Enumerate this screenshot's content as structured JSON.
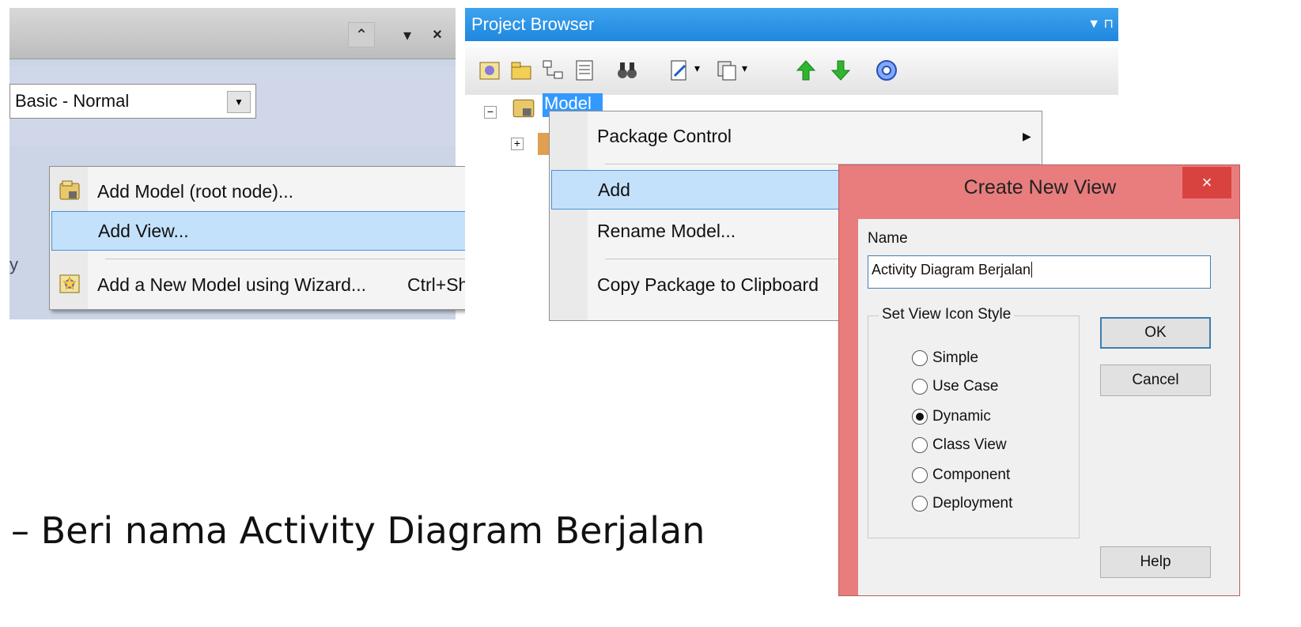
{
  "left_panel": {
    "style_select_value": "Basic - Normal",
    "stub_text": "y"
  },
  "add_submenu": {
    "items": [
      {
        "label": "Add Model (root node)...",
        "shortcut": ""
      },
      {
        "label": "Add View...",
        "shortcut": ""
      },
      {
        "label": "Add a New Model using Wizard...",
        "shortcut": "Ctrl+Shift+M"
      }
    ]
  },
  "project_browser": {
    "title": "Project Browser",
    "tree_root": "Model"
  },
  "context_menu": {
    "items": [
      {
        "label": "Package Control"
      },
      {
        "label": "Add"
      },
      {
        "label": "Rename Model..."
      },
      {
        "label": "Copy Package to Clipboard"
      }
    ]
  },
  "dialog": {
    "title": "Create New View",
    "close_glyph": "×",
    "name_label": "Name",
    "name_value": "Activity Diagram Berjalan",
    "icon_style_label": "Set View Icon Style",
    "radio_options": [
      "Simple",
      "Use Case",
      "Dynamic",
      "Class View",
      "Component",
      "Deployment"
    ],
    "selected_option": "Dynamic",
    "ok_label": "OK",
    "cancel_label": "Cancel",
    "help_label": "Help"
  },
  "caption": "– Beri nama Activity Diagram Berjalan",
  "colors": {
    "menu_highlight": "#c4e1fb",
    "browser_title": "#2a93e4",
    "dialog_frame": "#e97d7d",
    "close_button": "#d9433f"
  }
}
